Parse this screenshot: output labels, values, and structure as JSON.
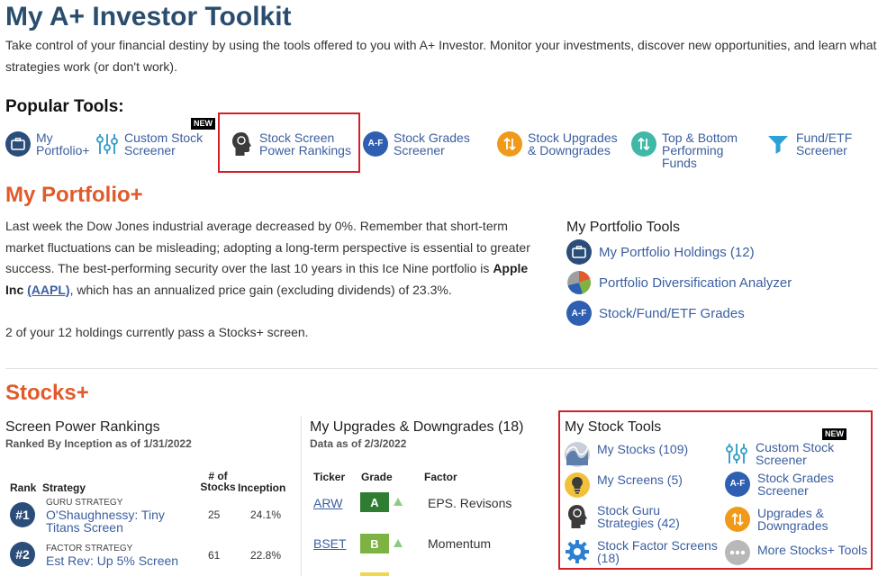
{
  "page": {
    "title": "My A+ Investor Toolkit",
    "intro": "Take control of your financial destiny by using the tools offered to you with A+ Investor. Monitor your investments, discover new opportunities, and learn what strategies work (or don't work)."
  },
  "popular": {
    "heading": "Popular Tools:",
    "new_badge": "NEW",
    "tools": [
      {
        "label": "My\nPortfolio+",
        "icon": "briefcase-icon"
      },
      {
        "label": "Custom Stock\nScreener",
        "icon": "sliders-icon"
      },
      {
        "label": "Stock Screen\nPower Rankings",
        "icon": "head-icon"
      },
      {
        "label": "Stock Grades\nScreener",
        "icon": "af-grade-icon",
        "icon_text": "A-F"
      },
      {
        "label": "Stock Upgrades\n& Downgrades",
        "icon": "up-down-arrows-icon"
      },
      {
        "label": "Top & Bottom\nPerforming\nFunds",
        "icon": "arrows-cycle-icon"
      },
      {
        "label": "Fund/ETF\nScreener",
        "icon": "filter-icon"
      }
    ]
  },
  "portfolio": {
    "title": "My Portfolio+",
    "p1_a": "Last week the Dow Jones industrial average decreased by 0%. Remember that short-term market fluctuations can be misleading; adopting a long-term perspective is essential to greater success. The best-performing security over the last 10 years in this Ice Nine portfolio is ",
    "company": "Apple Inc",
    "ticker_link": "(AAPL)",
    "p1_b": ", which has an annualized price gain (excluding dividends) of 23.3%.",
    "p2": "2 of your 12 holdings currently pass a Stocks+ screen.",
    "tools_heading": "My Portfolio Tools",
    "tools": [
      {
        "label": "My Portfolio Holdings (12)",
        "icon": "briefcase-icon"
      },
      {
        "label": "Portfolio Diversification Analyzer",
        "icon": "pie-chart-icon"
      },
      {
        "label": "Stock/Fund/ETF Grades",
        "icon": "af-grade-icon",
        "icon_text": "A-F"
      }
    ]
  },
  "stocks": {
    "title": "Stocks+",
    "rankings": {
      "heading": "Screen Power Rankings",
      "sub": "Ranked By Inception as of 1/31/2022",
      "col_rank": "Rank",
      "col_strategy": "Strategy",
      "col_num": "# of\nStocks",
      "col_inception": "Inception",
      "rows": [
        {
          "rank": "#1",
          "type": "GURU STRATEGY",
          "name": "O'Shaughnessy: Tiny\nTitans Screen",
          "stocks": "25",
          "inception": "24.1%"
        },
        {
          "rank": "#2",
          "type": "FACTOR STRATEGY",
          "name": "Est Rev: Up 5% Screen",
          "stocks": "61",
          "inception": "22.8%"
        }
      ]
    },
    "upgrades": {
      "heading": "My Upgrades & Downgrades (18)",
      "sub": "Data as of 2/3/2022",
      "col_ticker": "Ticker",
      "col_grade": "Grade",
      "col_factor": "Factor",
      "rows": [
        {
          "ticker": "ARW",
          "grade": "A",
          "grade_color": "#2e7d32",
          "factor": "EPS. Revisons"
        },
        {
          "ticker": "BSET",
          "grade": "B",
          "grade_color": "#7cb342",
          "factor": "Momentum"
        }
      ]
    },
    "tools": {
      "heading": "My Stock Tools",
      "new_badge": "NEW",
      "left": [
        {
          "label": "My Stocks (109)",
          "icon": "stocks-wave-icon"
        },
        {
          "label": "My Screens (5)",
          "icon": "lightbulb-icon"
        },
        {
          "label": "Stock Guru\nStrategies (42)",
          "icon": "head-icon"
        },
        {
          "label": "Stock Factor Screens\n(18)",
          "icon": "gear-icon"
        }
      ],
      "right": [
        {
          "label": "Custom Stock\nScreener",
          "icon": "sliders-icon"
        },
        {
          "label": "Stock Grades\nScreener",
          "icon": "af-grade-icon",
          "icon_text": "A-F"
        },
        {
          "label": "Upgrades &\nDowngrades",
          "icon": "up-down-arrows-icon"
        },
        {
          "label": "More Stocks+ Tools",
          "icon": "more-dots-icon"
        }
      ]
    }
  },
  "colors": {
    "title_blue": "#2a4d6e",
    "link_blue": "#3a5fa0",
    "section_orange": "#e05a2b",
    "highlight_red": "#d32027",
    "grade_a": "#2e7d32",
    "grade_b": "#7cb342"
  }
}
